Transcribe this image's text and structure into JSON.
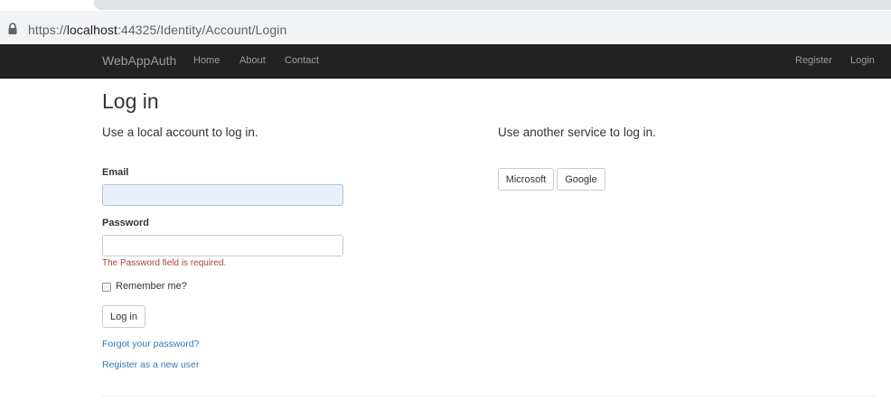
{
  "browser": {
    "url_scheme": "https://",
    "url_host": "localhost",
    "url_rest": ":44325/Identity/Account/Login"
  },
  "navbar": {
    "brand": "WebAppAuth",
    "links": [
      "Home",
      "About",
      "Contact"
    ],
    "right_links": [
      "Register",
      "Login"
    ]
  },
  "page": {
    "title": "Log in",
    "local_heading": "Use a local account to log in.",
    "external_heading": "Use another service to log in."
  },
  "form": {
    "email_label": "Email",
    "email_value": "",
    "password_label": "Password",
    "password_value": "",
    "password_error": "The Password field is required.",
    "remember_label": "Remember me?",
    "submit_label": "Log in",
    "forgot_link": "Forgot your password?",
    "register_link": "Register as a new user"
  },
  "external": {
    "providers": [
      "Microsoft",
      "Google"
    ]
  },
  "colors": {
    "navbar_bg": "#222222",
    "link": "#337ab7",
    "error": "#a94442",
    "autofill_bg": "#e8f0fe"
  }
}
